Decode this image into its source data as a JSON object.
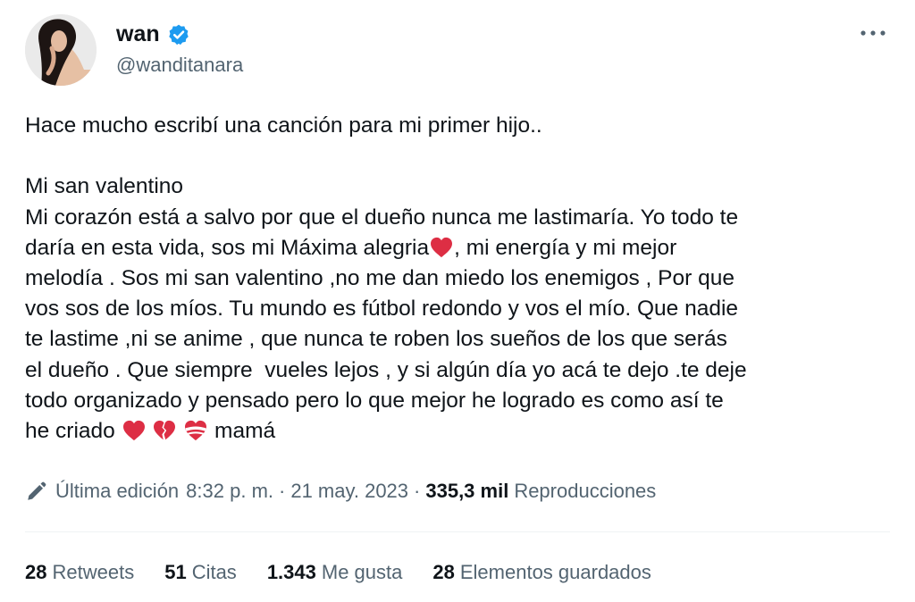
{
  "author": {
    "display_name": "wan",
    "handle": "@wanditanara",
    "verified_color": "#1d9bf0"
  },
  "tweet": {
    "line1": "Hace mucho escribí una canción para mi primer hijo..",
    "p_title": "Mi san valentino",
    "p_part1": "Mi corazón está a salvo por que el dueño nunca me lastimaría. Yo todo te\ndaría en esta vida, sos mi Máxima alegria",
    "p_part2": ", mi energía y mi mejor\nmelodía . Sos mi san valentino ,no me dan miedo los enemigos , Por que\nvos sos de los míos. Tu mundo es fútbol redondo y vos el mío. Que nadie\nte lastime ,ni se anime , que nunca te roben los sueños de los que serás\nel dueño . Que siempre  vueles lejos , y si algún día yo acá te dejo .te deje\ntodo organizado y pensado pero lo que mejor he logrado es como así te\nhe criado ",
    "p_end": " mamá",
    "emoji": [
      "red-heart",
      "broken-heart",
      "heart-with-ribbon"
    ]
  },
  "meta": {
    "edited_label": "Última edición",
    "time": "8:32 p. m.",
    "date": "21 may. 2023",
    "views_count": "335,3 mil",
    "views_label": "Reproducciones",
    "separator": "·"
  },
  "stats": [
    {
      "count": "28",
      "label": "Retweets"
    },
    {
      "count": "51",
      "label": "Citas"
    },
    {
      "count": "1.343",
      "label": "Me gusta"
    },
    {
      "count": "28",
      "label": "Elementos guardados"
    }
  ],
  "colors": {
    "heart_red": "#dd2e44",
    "secondary_text": "#536471",
    "divider": "#eff3f4"
  }
}
